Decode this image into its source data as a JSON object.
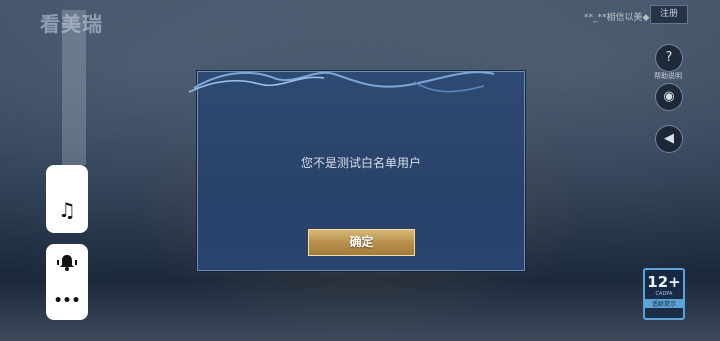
{
  "background": {
    "logo_text": "看美瑞",
    "account_text": "**_**相信以美◆",
    "top_button_label": "注册",
    "help_label": "帮助说明",
    "icons": [
      "question-icon",
      "camera-icon",
      "speaker-icon"
    ]
  },
  "age_rating": {
    "number": "12+",
    "sub": "CADPA",
    "footer": "适龄提示"
  },
  "side_tools": {
    "music_icon": "♫",
    "bell_icon": "🔔",
    "more_icon": "•••"
  },
  "dialog": {
    "message": "您不是测试白名单用户",
    "confirm_label": "确定"
  },
  "colors": {
    "dialog_bg": "#2f4a72",
    "button_gold": "#c9a662",
    "pill_bg": "#ffffff"
  }
}
